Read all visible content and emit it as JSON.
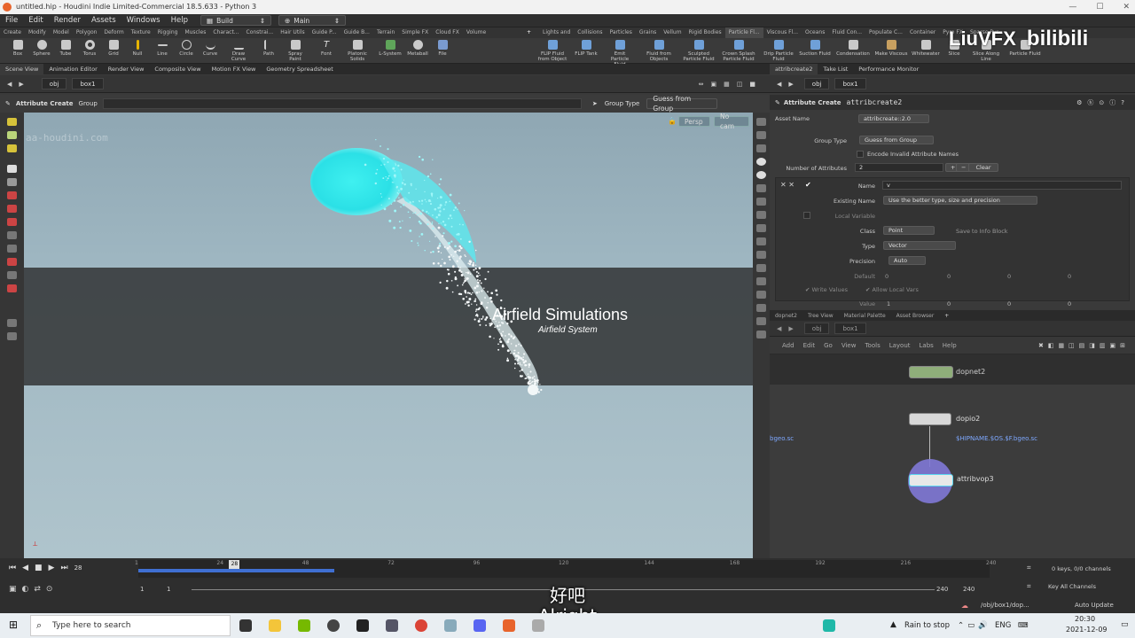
{
  "window": {
    "title": "untitled.hip - Houdini Indie Limited-Commercial 18.5.633 - Python 3"
  },
  "menu": {
    "items": [
      "File",
      "Edit",
      "Render",
      "Assets",
      "Windows",
      "Help"
    ],
    "desktop": "Build",
    "layout": "Main"
  },
  "shelf_tabs": [
    "Create",
    "Modify",
    "Model",
    "Polygon",
    "Deform",
    "Texture",
    "Rigging",
    "Muscles",
    "Charact...",
    "Constrai...",
    "Hair Utils",
    "Guide P...",
    "Guide B...",
    "Terrain",
    "Simple FX",
    "Cloud FX",
    "Volume",
    "Lights and",
    "Collisions",
    "Particles",
    "Grains",
    "Vellum",
    "Rigid Bodies",
    "Particle Fl...",
    "Viscous Fl...",
    "Oceans",
    "Fluid Con...",
    "Populate C...",
    "Container",
    "Pyro FX",
    "Sparse Pyr...",
    "FEM",
    "Wires",
    "Crowds",
    "Drive Sim"
  ],
  "tools_left": [
    "Box",
    "Sphere",
    "Tube",
    "Torus",
    "Grid",
    "Null",
    "Line",
    "Circle",
    "Curve",
    "Draw Curve",
    "Path",
    "Spray Paint",
    "Font",
    "Platonic Solids",
    "L-System",
    "Metaball",
    "File"
  ],
  "tools_right": [
    "FLIP Fluid from Object",
    "FLIP Tank",
    "Emit Particle Fluid",
    "Fluid from Objects",
    "Sculpted Particle Fluid",
    "Crown Splash Particle Fluid",
    "Drip Particle Fluid",
    "Suction Fluid",
    "Condensation",
    "Make Viscous",
    "Whitewater",
    "Slice",
    "Slice Along Line",
    "Particle Fluid"
  ],
  "left_tabs": [
    "Scene View",
    "Animation Editor",
    "Render View",
    "Composite View",
    "Motion FX View",
    "Geometry Spreadsheet"
  ],
  "right_tabs": [
    "attribcreate2",
    "Take List",
    "Performance Monitor"
  ],
  "left_path": {
    "root": "obj",
    "node": "box1"
  },
  "right_path": {
    "root": "obj",
    "node": "box1"
  },
  "viewport": {
    "op_name": "Attribute Create",
    "op_group": "Group",
    "group_type_label": "Group Type",
    "group_type_value": "Guess from Group",
    "persp": "Persp",
    "cam": "No cam",
    "watermark": "aa-houdini.com",
    "overlay_title": "Airfield Simulations",
    "overlay_subtitle": "Airfield System"
  },
  "params": {
    "op_type": "Attribute Create",
    "node_name": "attribcreate2",
    "asset_name_label": "Asset Name",
    "asset_name": "attribcreate::2.0",
    "group_type_label": "Group Type",
    "group_type": "Guess from Group",
    "encode_label": "Encode Invalid Attribute Names",
    "num_attr_label": "Number of Attributes",
    "num_attr": "2",
    "clear": "Clear",
    "name_label": "Name",
    "name": "v",
    "existing_label": "Existing Name",
    "existing": "Use the better type, size and precision",
    "local_label": "Local Variable",
    "class_label": "Class",
    "class": "Point",
    "save_info": "Save to Info Block",
    "type_label": "Type",
    "type": "Vector",
    "precision_label": "Precision",
    "precision": "Auto",
    "default_label": "Default",
    "default_vals": [
      "0",
      "0",
      "0",
      "0"
    ],
    "write_values": "Write Values",
    "allow_local": "Allow Local Vars",
    "value_label": "Value",
    "value_vals": [
      "1",
      "0",
      "0",
      "0"
    ]
  },
  "net": {
    "tabs": [
      "dopnet2",
      "Tree View",
      "Material Palette",
      "Asset Browser"
    ],
    "path_root": "obj",
    "path_node": "box1",
    "menu": [
      "Add",
      "Edit",
      "Go",
      "View",
      "Tools",
      "Layout",
      "Labs",
      "Help"
    ],
    "nodes": [
      {
        "name": "dopnet2",
        "sub": ""
      },
      {
        "name": "dopio2",
        "sub": "$HIPNAME.$OS.$F.bgeo.sc"
      },
      {
        "name": "attribvop3",
        "sub": ""
      }
    ],
    "cut_label": "bgeo.sc"
  },
  "timeline": {
    "frame": "28",
    "ticks": [
      "1",
      "24",
      "48",
      "72",
      "96",
      "120",
      "144",
      "168",
      "192",
      "216",
      "240"
    ],
    "start": "1",
    "start2": "1",
    "end": "240",
    "end2": "240",
    "keys": "0 keys, 0/0 channels",
    "key_all": "Key All Channels",
    "path": "/obj/box1/dop...",
    "auto_update": "Auto Update"
  },
  "subtitles": {
    "cn": "好吧",
    "en": "Alright"
  },
  "taskbar": {
    "search_placeholder": "Type here to search",
    "weather": "Rain to stop",
    "lang": "ENG",
    "time": "20:30",
    "date": "2021-12-09"
  },
  "brand": {
    "watermark": "LiuVFX",
    "site": "bilibili"
  }
}
